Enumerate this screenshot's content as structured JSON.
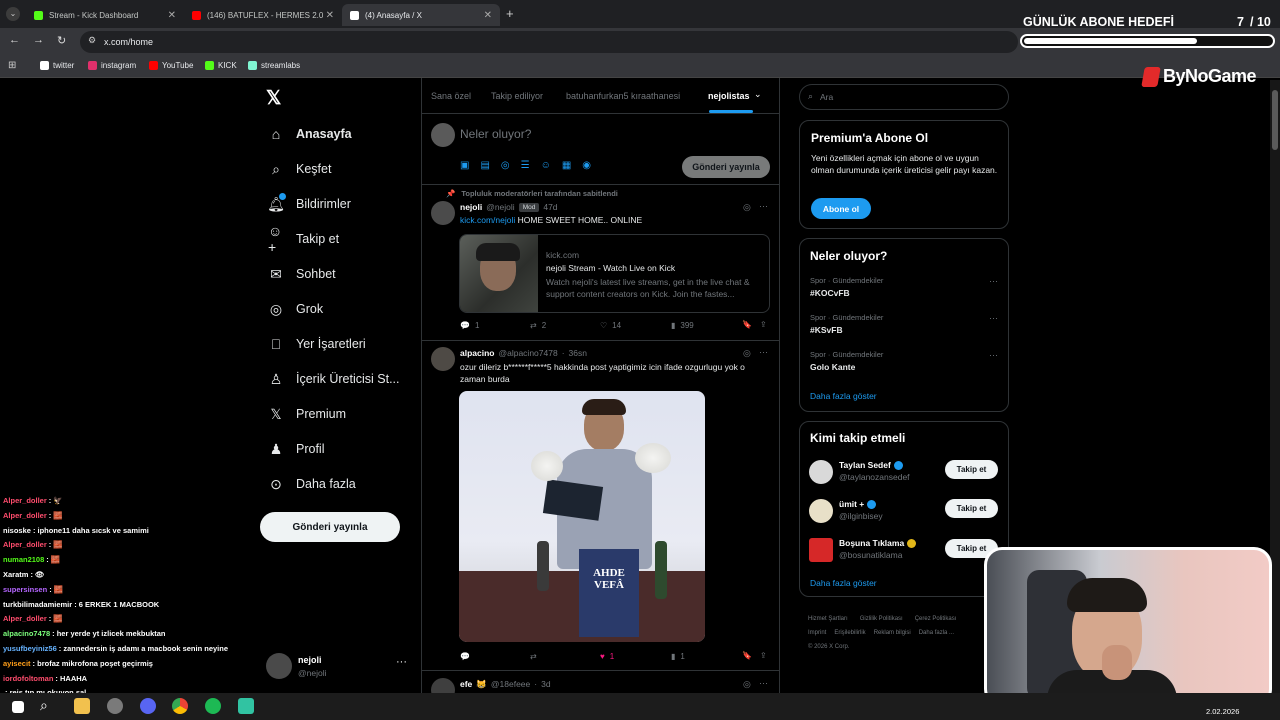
{
  "browser": {
    "tabs": [
      {
        "label": "Stream - Kick Dashboard",
        "color": "#53fc18"
      },
      {
        "label": "(146) BATUFLEX - HERMES 2.0",
        "color": "#ff0000"
      },
      {
        "label": "(4) Anasayfa / X",
        "color": "#ffffff"
      }
    ],
    "url": "x.com/home",
    "bookmarks": [
      {
        "label": "twitter",
        "color": "#ffffff"
      },
      {
        "label": "instagram",
        "color": "#e1306c"
      },
      {
        "label": "YouTube",
        "color": "#ff0000"
      },
      {
        "label": "KICK",
        "color": "#53fc18"
      },
      {
        "label": "streamlabs",
        "color": "#80f5d2"
      }
    ]
  },
  "overlay": {
    "goal_title": "GÜNLÜK ABONE HEDEFİ",
    "goal_count": "7",
    "goal_total": "/ 10",
    "goal_progress": 0.7,
    "brand": "ByNoGame"
  },
  "sidebar": {
    "items": [
      {
        "label": "Anasayfa",
        "icon": "home-icon"
      },
      {
        "label": "Keşfet",
        "icon": "search-icon"
      },
      {
        "label": "Bildirimler",
        "icon": "bell-icon"
      },
      {
        "label": "Takip et",
        "icon": "add-person-icon"
      },
      {
        "label": "Sohbet",
        "icon": "mail-icon"
      },
      {
        "label": "Grok",
        "icon": "grok-icon"
      },
      {
        "label": "Yer İşaretleri",
        "icon": "bookmark-icon"
      },
      {
        "label": "İçerik Üreticisi St...",
        "icon": "creator-icon"
      },
      {
        "label": "Premium",
        "icon": "x-icon"
      },
      {
        "label": "Profil",
        "icon": "person-icon"
      },
      {
        "label": "Daha fazla",
        "icon": "more-circle-icon"
      }
    ],
    "post_button": "Gönderi yayınla",
    "account": {
      "name": "nejoli",
      "handle": "@nejoli"
    }
  },
  "feed": {
    "tabs": [
      "Sana özel",
      "Takip ediliyor",
      "batuhanfurkan5 kıraathanesi",
      "nejolistas"
    ],
    "composer_placeholder": "Neler oluyor?",
    "composer_button": "Gönderi yayınla",
    "posts": [
      {
        "pinned_note": "Topluluk moderatörleri tarafından sabitlendi",
        "name": "nejoli",
        "handle": "@nejoli",
        "badge": "Mod",
        "time": "47d",
        "link": "kick.com/nejoli",
        "text": "HOME SWEET HOME.. ONLINE",
        "card_domain": "kick.com",
        "card_title": "nejoli Stream - Watch Live on Kick",
        "card_desc": "Watch nejoli's latest live streams, get in the live chat & support content creators on Kick. Join the fastes...",
        "replies": "1",
        "reposts": "2",
        "likes": "14",
        "views": "399"
      },
      {
        "name": "alpacino",
        "handle": "@alpacino7478",
        "time": "36sn",
        "text": "ozur dileriz b******f*****5 hakkinda post yaptigimiz icin ifade ozgurlugu yok o zaman burda",
        "replies": "",
        "reposts": "",
        "likes": "1",
        "views": "1"
      },
      {
        "name": "efe",
        "handle": "@18efeee",
        "time": "3d"
      }
    ],
    "book_title_1": "AHDE",
    "book_title_2": "VEFÂ"
  },
  "right": {
    "search_placeholder": "Ara",
    "premium": {
      "title": "Premium'a Abone Ol",
      "desc": "Yeni özellikleri açmak için abone ol ve uygun olman durumunda içerik üreticisi gelir payı kazan.",
      "button": "Abone ol"
    },
    "trends": {
      "title": "Neler oluyor?",
      "items": [
        {
          "category": "Spor · Gündemdekiler",
          "tag": "#KOCvFB"
        },
        {
          "category": "Spor · Gündemdekiler",
          "tag": "#KSvFB"
        },
        {
          "category": "Spor · Gündemdekiler",
          "tag": "Golo Kante"
        }
      ],
      "more": "Daha fazla göster"
    },
    "who": {
      "title": "Kimi takip etmeli",
      "items": [
        {
          "name": "Taylan Sedef",
          "handle": "@taylanozansedef",
          "badge": "#1d9bf0"
        },
        {
          "name": "ümit +",
          "handle": "@ilginbisey",
          "badge": "#1d9bf0"
        },
        {
          "name": "Boşuna Tıklama",
          "handle": "@bosunatiklama",
          "badge": "#e2b719"
        }
      ],
      "follow": "Takip et",
      "more": "Daha fazla göster"
    },
    "footer": [
      "Hizmet Şartları",
      "Gizlilik Politikası",
      "Çerez Politikası",
      "Imprint",
      "Erişilebilirlik",
      "Reklam bilgisi",
      "Daha fazla ...",
      "© 2026 X Corp."
    ]
  },
  "chat": [
    {
      "user": "Alper_doller",
      "msg": ": 🦅",
      "color": "#ff4d6d"
    },
    {
      "user": "Alper_doller",
      "msg": ": 🧱",
      "color": "#ff4d6d"
    },
    {
      "user": "nisoske",
      "msg": ": iphone11 daha sıcsk ve samimi",
      "color": "#ffffff"
    },
    {
      "user": "Alper_doller",
      "msg": ": 🧱",
      "color": "#ff4d6d"
    },
    {
      "user": "numan2108",
      "msg": ": 🧱",
      "color": "#53fc18"
    },
    {
      "user": "Xaratm",
      "msg": ": 👁",
      "color": "#ffffff"
    },
    {
      "user": "supersinsen",
      "msg": ": 🧱",
      "color": "#b566ff"
    },
    {
      "user": "turkbilimadamiemir",
      "msg": ": 6 ERKEK 1 MACBOOK",
      "color": "#ffffff"
    },
    {
      "user": "Alper_doller",
      "msg": ": 🧱",
      "color": "#ff4d6d"
    },
    {
      "user": "alpacino7478",
      "msg": ": her yerde yt izlicek mekbuktan",
      "color": "#7cff7c"
    },
    {
      "user": "yusufbeyiniz56",
      "msg": ": zannedersin iş adamı a macbook senin neyine",
      "color": "#66b3ff"
    },
    {
      "user": "ayisecit",
      "msg": ": brofaz mikrofona poşet geçirmiş",
      "color": "#ff9f1a"
    },
    {
      "user": "iordofoltoman",
      "msg": ": HAAHA",
      "color": "#ff4d6d"
    },
    {
      "user": "",
      "msg": ": reis tıp mı okuyon sal",
      "color": "#ffffff"
    }
  ],
  "taskbar": {
    "date": "2.02.2026"
  }
}
